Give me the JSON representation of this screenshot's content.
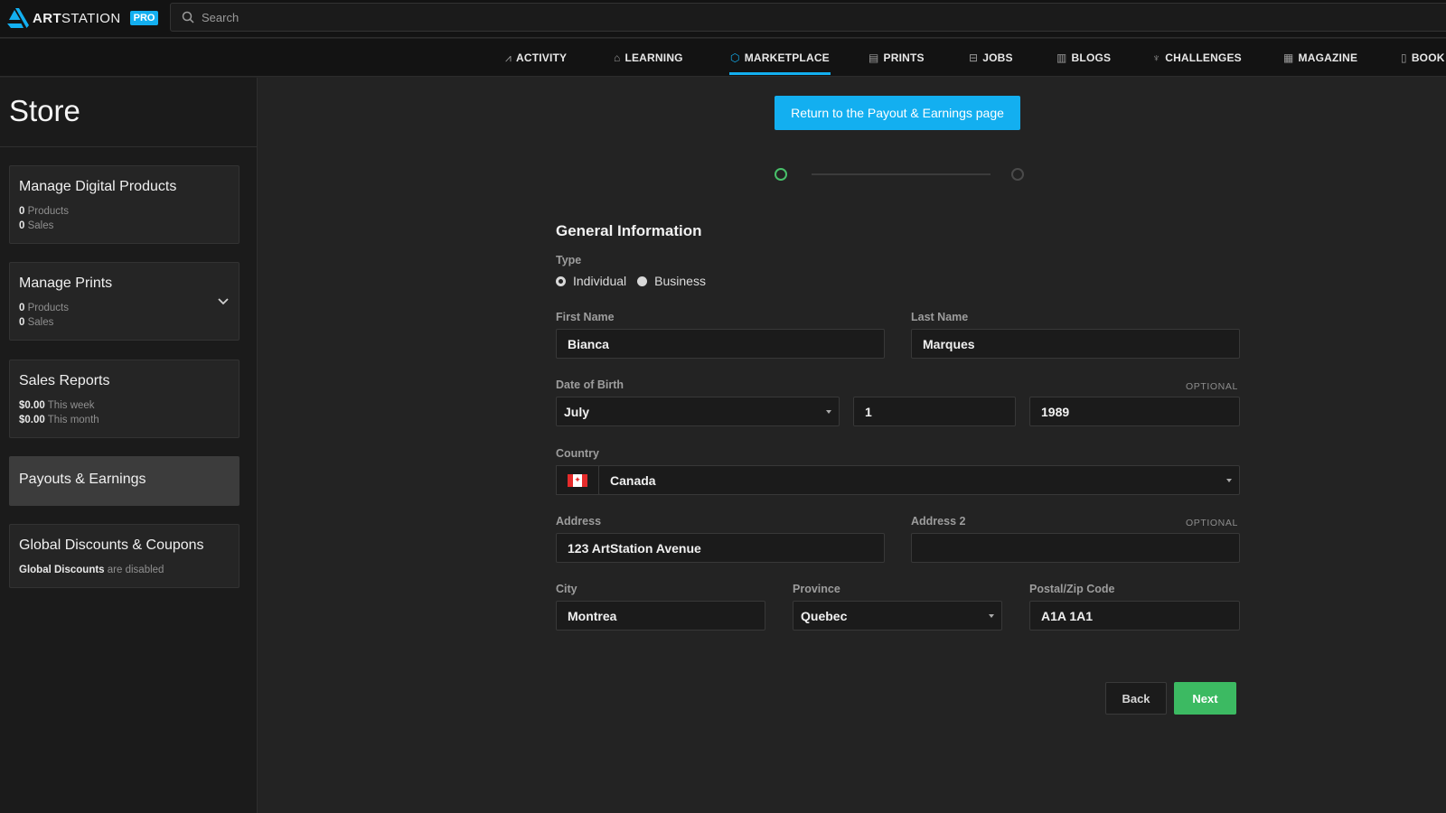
{
  "brand": {
    "name_bold": "ART",
    "name_rest": "STATION",
    "badge": "PRO",
    "accent": "#13aff0"
  },
  "search": {
    "placeholder": "Search"
  },
  "nav": [
    {
      "label": "ACTIVITY",
      "icon": "activity-icon"
    },
    {
      "label": "LEARNING",
      "icon": "graduation-cap-icon"
    },
    {
      "label": "MARKETPLACE",
      "icon": "cube-icon",
      "active": true
    },
    {
      "label": "PRINTS",
      "icon": "print-icon"
    },
    {
      "label": "JOBS",
      "icon": "briefcase-icon"
    },
    {
      "label": "BLOGS",
      "icon": "document-icon"
    },
    {
      "label": "CHALLENGES",
      "icon": "trophy-icon"
    },
    {
      "label": "MAGAZINE",
      "icon": "newspaper-icon"
    },
    {
      "label": "BOOK",
      "icon": "book-icon"
    }
  ],
  "sidebar": {
    "title": "Store",
    "cards": [
      {
        "title": "Manage Digital Products",
        "lines": [
          {
            "value": "0",
            "text": "Products"
          },
          {
            "value": "0",
            "text": "Sales"
          }
        ]
      },
      {
        "title": "Manage Prints",
        "lines": [
          {
            "value": "0",
            "text": "Products"
          },
          {
            "value": "0",
            "text": "Sales"
          }
        ]
      },
      {
        "title": "Sales Reports",
        "lines": [
          {
            "value": "$0.00",
            "text": "This week"
          },
          {
            "value": "$0.00",
            "text": "This month"
          }
        ]
      },
      {
        "title": "Payouts & Earnings",
        "active": true
      },
      {
        "title": "Global Discounts & Coupons",
        "lines": [
          {
            "value": "Global Discounts",
            "text": "are disabled"
          }
        ]
      }
    ]
  },
  "main": {
    "return_button": "Return to the Payout & Earnings page",
    "section_title": "General Information",
    "type_label": "Type",
    "type_options": [
      "Individual",
      "Business"
    ],
    "type_selected": "Individual",
    "first_name_label": "First Name",
    "first_name": "Bianca",
    "last_name_label": "Last Name",
    "last_name": "Marques",
    "dob_label": "Date of Birth",
    "optional": "OPTIONAL",
    "dob_month": "July",
    "dob_day": "1",
    "dob_year": "1989",
    "country_label": "Country",
    "country": "Canada",
    "address_label": "Address",
    "address": "123 ArtStation Avenue",
    "address2_label": "Address 2",
    "address2": "",
    "city_label": "City",
    "city": "Montrea",
    "province_label": "Province",
    "province": "Quebec",
    "postal_label": "Postal/Zip Code",
    "postal": "A1A 1A1",
    "back_button": "Back",
    "next_button": "Next",
    "next_color": "#3cba62"
  }
}
